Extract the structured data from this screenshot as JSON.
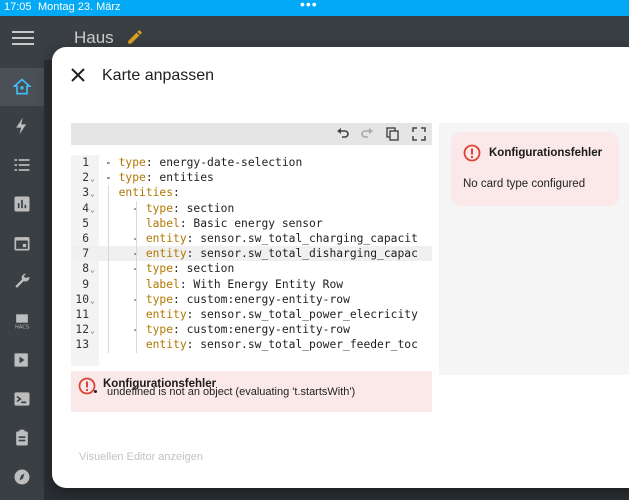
{
  "statusbar": {
    "time": "17:05",
    "date": "Montag 23. März",
    "dots": "•••"
  },
  "app": {
    "title": "Haus"
  },
  "sidebar": {
    "items": [
      {
        "icon": "home-assistant-icon",
        "active": true
      },
      {
        "icon": "lightning-bolt-icon"
      },
      {
        "icon": "list-icon"
      },
      {
        "icon": "bar-chart-icon"
      },
      {
        "icon": "calendar-icon"
      },
      {
        "icon": "wrench-icon"
      },
      {
        "icon": "hacs-icon",
        "label": "HACS"
      },
      {
        "icon": "media-play-icon"
      },
      {
        "icon": "terminal-icon"
      },
      {
        "icon": "clipboard-icon"
      },
      {
        "icon": "compass-icon"
      }
    ]
  },
  "dialog": {
    "title": "Karte anpassen",
    "close_label": "✕",
    "visual_editor_label": "Visuellen Editor anzeigen"
  },
  "editor": {
    "toolbar": [
      "undo-icon",
      "redo-icon",
      "copy-icon",
      "fullscreen-icon"
    ],
    "lines": [
      {
        "num": "1",
        "fold": "",
        "text": "- type: energy-date-selection"
      },
      {
        "num": "2",
        "fold": "v",
        "text": "- type: entities"
      },
      {
        "num": "3",
        "fold": "v",
        "text": "  entities:"
      },
      {
        "num": "4",
        "fold": "v",
        "text": "    - type: section"
      },
      {
        "num": "5",
        "fold": "",
        "text": "      label: Basic energy sensor"
      },
      {
        "num": "6",
        "fold": "",
        "text": "    - entity: sensor.sw_total_charging_capacit"
      },
      {
        "num": "7",
        "fold": "",
        "text": "    - entity: sensor.sw_total_disharging_capac"
      },
      {
        "num": "8",
        "fold": "v",
        "text": "    - type: section"
      },
      {
        "num": "9",
        "fold": "",
        "text": "      label: With Energy Entity Row"
      },
      {
        "num": "10",
        "fold": "v",
        "text": "    - type: custom:energy-entity-row"
      },
      {
        "num": "11",
        "fold": "",
        "text": "      entity: sensor.sw_total_power_elecricity"
      },
      {
        "num": "12",
        "fold": "v",
        "text": "    - type: custom:energy-entity-row"
      },
      {
        "num": "13",
        "fold": "",
        "text": "      entity: sensor.sw_total_power_feeder_toc"
      }
    ]
  },
  "yaml_error": {
    "title": "Konfigurationsfehler",
    "message": "undefined is not an object (evaluating 't.startsWith')"
  },
  "preview": {
    "title": "Konfigurationsfehler",
    "message": "No card type configured"
  },
  "colors": {
    "accent": "#03a9f4",
    "error": "#db4437",
    "error_bg": "#fbe8e8",
    "yaml_key": "#b07800"
  }
}
